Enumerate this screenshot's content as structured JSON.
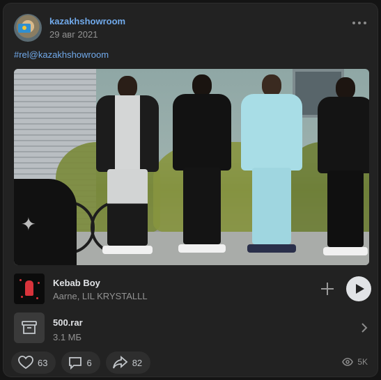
{
  "post": {
    "author": "kazakhshowroom",
    "date": "29 авг 2021",
    "hashtag": "#rel@kazakhshowroom"
  },
  "audio": {
    "title": "Kebab Boy",
    "artist": "Aarne, LIL KRYSTALLL"
  },
  "document": {
    "name": "500.rar",
    "size": "3.1 МБ"
  },
  "actions": {
    "likes": "63",
    "comments": "6",
    "shares": "82",
    "views": "5K"
  },
  "colors": {
    "link": "#71aaeb",
    "card_bg": "#222222",
    "secondary_text": "#939393"
  },
  "icons": [
    "more-icon",
    "add-icon",
    "play-icon",
    "archive-icon",
    "chevron-right-icon",
    "heart-icon",
    "comment-icon",
    "share-icon",
    "eye-icon"
  ]
}
